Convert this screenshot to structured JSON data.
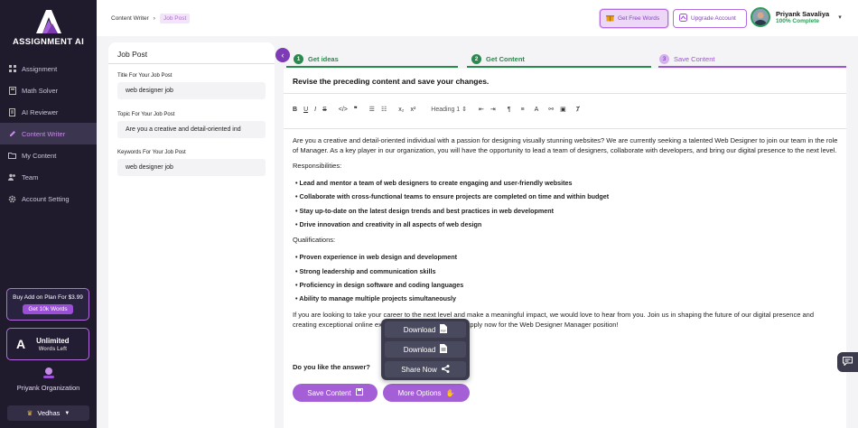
{
  "brand": {
    "name": "ASSIGNMENT AI"
  },
  "sidebar": {
    "items": [
      {
        "label": "Assignment",
        "icon": "grid-icon"
      },
      {
        "label": "Math Solver",
        "icon": "calculator-icon"
      },
      {
        "label": "AI Reviewer",
        "icon": "document-icon"
      },
      {
        "label": "Content Writer",
        "icon": "pen-icon",
        "active": true
      },
      {
        "label": "My Content",
        "icon": "folder-icon"
      },
      {
        "label": "Team",
        "icon": "team-icon"
      },
      {
        "label": "Account Setting",
        "icon": "gear-icon"
      }
    ],
    "addon": {
      "title": "Buy Add on Plan For $3.99",
      "button": "Get 10k Words"
    },
    "plan": {
      "title": "Unlimited",
      "subtitle": "Words Left"
    },
    "org": "Priyank Organization",
    "workspace": "Vedhas"
  },
  "header": {
    "breadcrumb": [
      "Content Writer",
      "Job Post"
    ],
    "free_words": "Get Free Words",
    "upgrade": "Upgrade Account",
    "user_name": "Priyank Savaliya",
    "user_status": "100% Complete"
  },
  "left_panel": {
    "title": "Job Post",
    "fields": [
      {
        "label": "Title For Your Job Post",
        "value": "web designer job"
      },
      {
        "label": "Topic For Your Job Post",
        "value": "Are you a creative and detail-oriented ind"
      },
      {
        "label": "Keywords For Your Job Post",
        "value": "web designer job"
      }
    ]
  },
  "steps": [
    {
      "num": "1",
      "label": "Get ideas"
    },
    {
      "num": "2",
      "label": "Get Content"
    },
    {
      "num": "3",
      "label": "Save Content"
    }
  ],
  "editor": {
    "instruction": "Revise the preceding content and save your changes.",
    "heading_select": "Heading 1",
    "intro": "Are you a creative and detail-oriented individual with a passion for designing visually stunning websites? We are currently seeking a talented Web Designer to join our team in the role of Manager. As a key player in our organization, you will have the opportunity to lead a team of designers, collaborate with developers, and bring our digital presence to the next level.",
    "resp_title": "Responsibilities:",
    "responsibilities": [
      "Lead and mentor a team of web designers to create engaging and user-friendly websites",
      "Collaborate with cross-functional teams to ensure projects are completed on time and within budget",
      "Stay up-to-date on the latest design trends and best practices in web development",
      "Drive innovation and creativity in all aspects of web design"
    ],
    "qual_title": "Qualifications:",
    "qualifications": [
      "Proven experience in web design and development",
      "Strong leadership and communication skills",
      "Proficiency in design software and coding languages",
      "Ability to manage multiple projects simultaneously"
    ],
    "closing": "If you are looking to take your career to the next level and make a meaningful impact, we would love to hear from you. Join us in shaping the future of our digital presence and creating exceptional online experiences for our audience. Apply now for the Web Designer Manager position!",
    "like_question": "Do you like the answer?",
    "save_label": "Save Content",
    "more_label": "More Options"
  },
  "popup": {
    "items": [
      "Download",
      "Download",
      "Share Now"
    ]
  },
  "colors": {
    "accent": "#a45fd6",
    "sidebar_bg": "#1f1b2d",
    "success": "#2a8a4d"
  }
}
